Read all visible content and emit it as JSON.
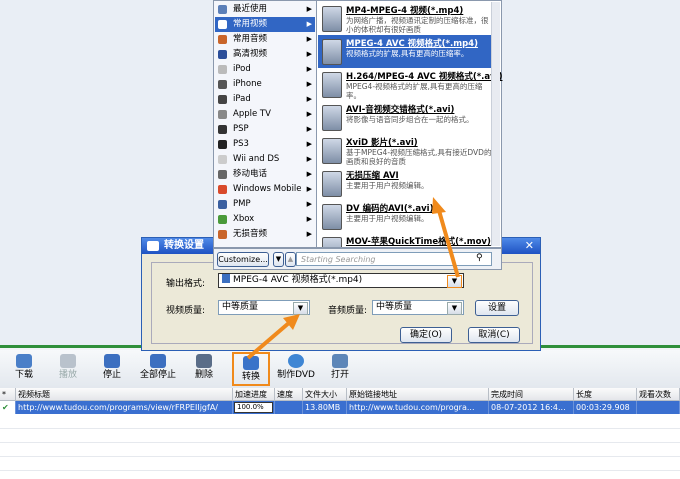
{
  "menu": {
    "items": [
      {
        "label": "最近使用",
        "icon": "clock-icon"
      },
      {
        "label": "常用视频",
        "icon": "video-icon"
      },
      {
        "label": "常用音频",
        "icon": "audio-icon"
      },
      {
        "label": "高清视频",
        "icon": "hd-icon"
      },
      {
        "label": "iPod",
        "icon": "ipod-icon"
      },
      {
        "label": "iPhone",
        "icon": "iphone-icon"
      },
      {
        "label": "iPad",
        "icon": "ipad-icon"
      },
      {
        "label": "Apple TV",
        "icon": "appletv-icon"
      },
      {
        "label": "PSP",
        "icon": "psp-icon"
      },
      {
        "label": "PS3",
        "icon": "ps3-icon"
      },
      {
        "label": "Wii and DS",
        "icon": "wii-icon"
      },
      {
        "label": "移动电话",
        "icon": "phone-icon"
      },
      {
        "label": "Windows Mobile",
        "icon": "windows-icon"
      },
      {
        "label": "PMP",
        "icon": "pmp-icon"
      },
      {
        "label": "Xbox",
        "icon": "xbox-icon"
      },
      {
        "label": "无损音频",
        "icon": "lossless-icon"
      }
    ]
  },
  "submenu": {
    "items": [
      {
        "title": "MP4-MPEG-4 视频(*.mp4)",
        "desc": "为网络广播，视频通讯定制的压缩标准，很小的体积却有很好画质"
      },
      {
        "title": "MPEG-4 AVC 视频格式(*.mp4)",
        "desc": "视频格式的扩展,具有更高的压缩率。"
      },
      {
        "title": "H.264/MPEG-4 AVC 视频格式(*.avi)",
        "desc": "MPEG4-视频格式的扩展,具有更高的压缩率。"
      },
      {
        "title": "AVI-音视频交错格式(*.avi)",
        "desc": "将影像与语音同步组合在一起的格式。"
      },
      {
        "title": "XviD 影片(*.avi)",
        "desc": "基于MPEG4-视频压缩格式,具有接近DVD的画质和良好的音质"
      },
      {
        "title": "无损压缩 AVI",
        "desc": "主要用于用户视频编辑。"
      },
      {
        "title": "DV 编码的AVI(*.avi)",
        "desc": "主要用于用户视频编辑。"
      },
      {
        "title": "MOV-苹果QuickTime格式(*.mov)",
        "desc": ""
      }
    ]
  },
  "popbar": {
    "customize": "Customize...",
    "search_placeholder": "Starting Searching"
  },
  "dialog": {
    "title": "转换设置",
    "output_format_label": "输出格式:",
    "output_format_value": "MPEG-4 AVC 视频格式(*.mp4)",
    "video_quality_label": "视频质量:",
    "video_quality_value": "中等质量",
    "audio_quality_label": "音频质量:",
    "audio_quality_value": "中等质量",
    "settings_button": "设置",
    "ok_button": "确定(O)",
    "cancel_button": "取消(C)"
  },
  "toolbar": {
    "download": "下载",
    "play": "播放",
    "stop": "停止",
    "stop_all": "全部停止",
    "delete": "删除",
    "convert": "转换",
    "make_dvd": "制作DVD",
    "open": "打开"
  },
  "grid": {
    "columns": [
      "*",
      "视频标题",
      "加速进度",
      "速度",
      "文件大小",
      "原始链接地址",
      "完成时间",
      "长度",
      "观看次数"
    ],
    "row": [
      "✔",
      "http://www.tudou.com/programs/view/rFRPEIIjgfA/",
      "100.0%",
      "",
      "13.80MB",
      "http://www.tudou.com/progra...",
      "08-07-2012 16:4...",
      "00:03:29.908",
      ""
    ]
  },
  "colors": {
    "accent": "#3166c4",
    "highlight": "#f08a1c",
    "green": "#2f8f3a"
  }
}
